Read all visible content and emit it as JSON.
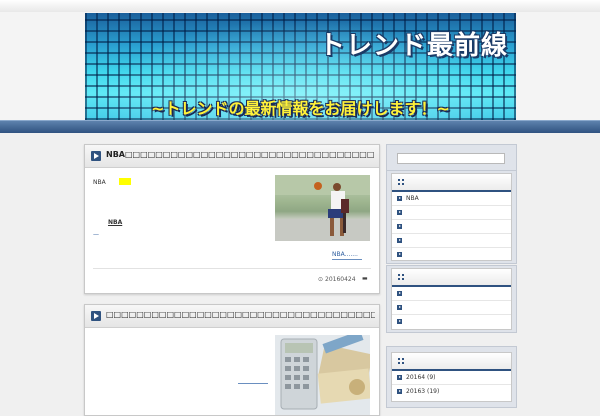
{
  "header": {
    "site_title": "トレンド最前線",
    "tagline": "~トレンドの最新情報をお届けします！~"
  },
  "posts": [
    {
      "title": "NBA□□□□□□□□□□□□□□□□□□□□□□□□□□□□□□□□□",
      "excerpt_word": "NBA",
      "excerpt_bold": "NBA",
      "excerpt_link": "—",
      "readmore": "NBA.......",
      "date": "20160424"
    },
    {
      "title": "□□□□□□□□□□□□□□□□□□□□□□□□□□□□□□□□□□□□□□□"
    }
  ],
  "sidebar": {
    "widget1_items": [
      {
        "label": "NBA"
      },
      {
        "label": ""
      },
      {
        "label": ""
      },
      {
        "label": ""
      },
      {
        "label": ""
      }
    ],
    "widget2_items": [
      {
        "label": ""
      },
      {
        "label": ""
      },
      {
        "label": ""
      }
    ],
    "archives": [
      {
        "label": "20164 (9)"
      },
      {
        "label": "20163 (19)"
      }
    ]
  }
}
